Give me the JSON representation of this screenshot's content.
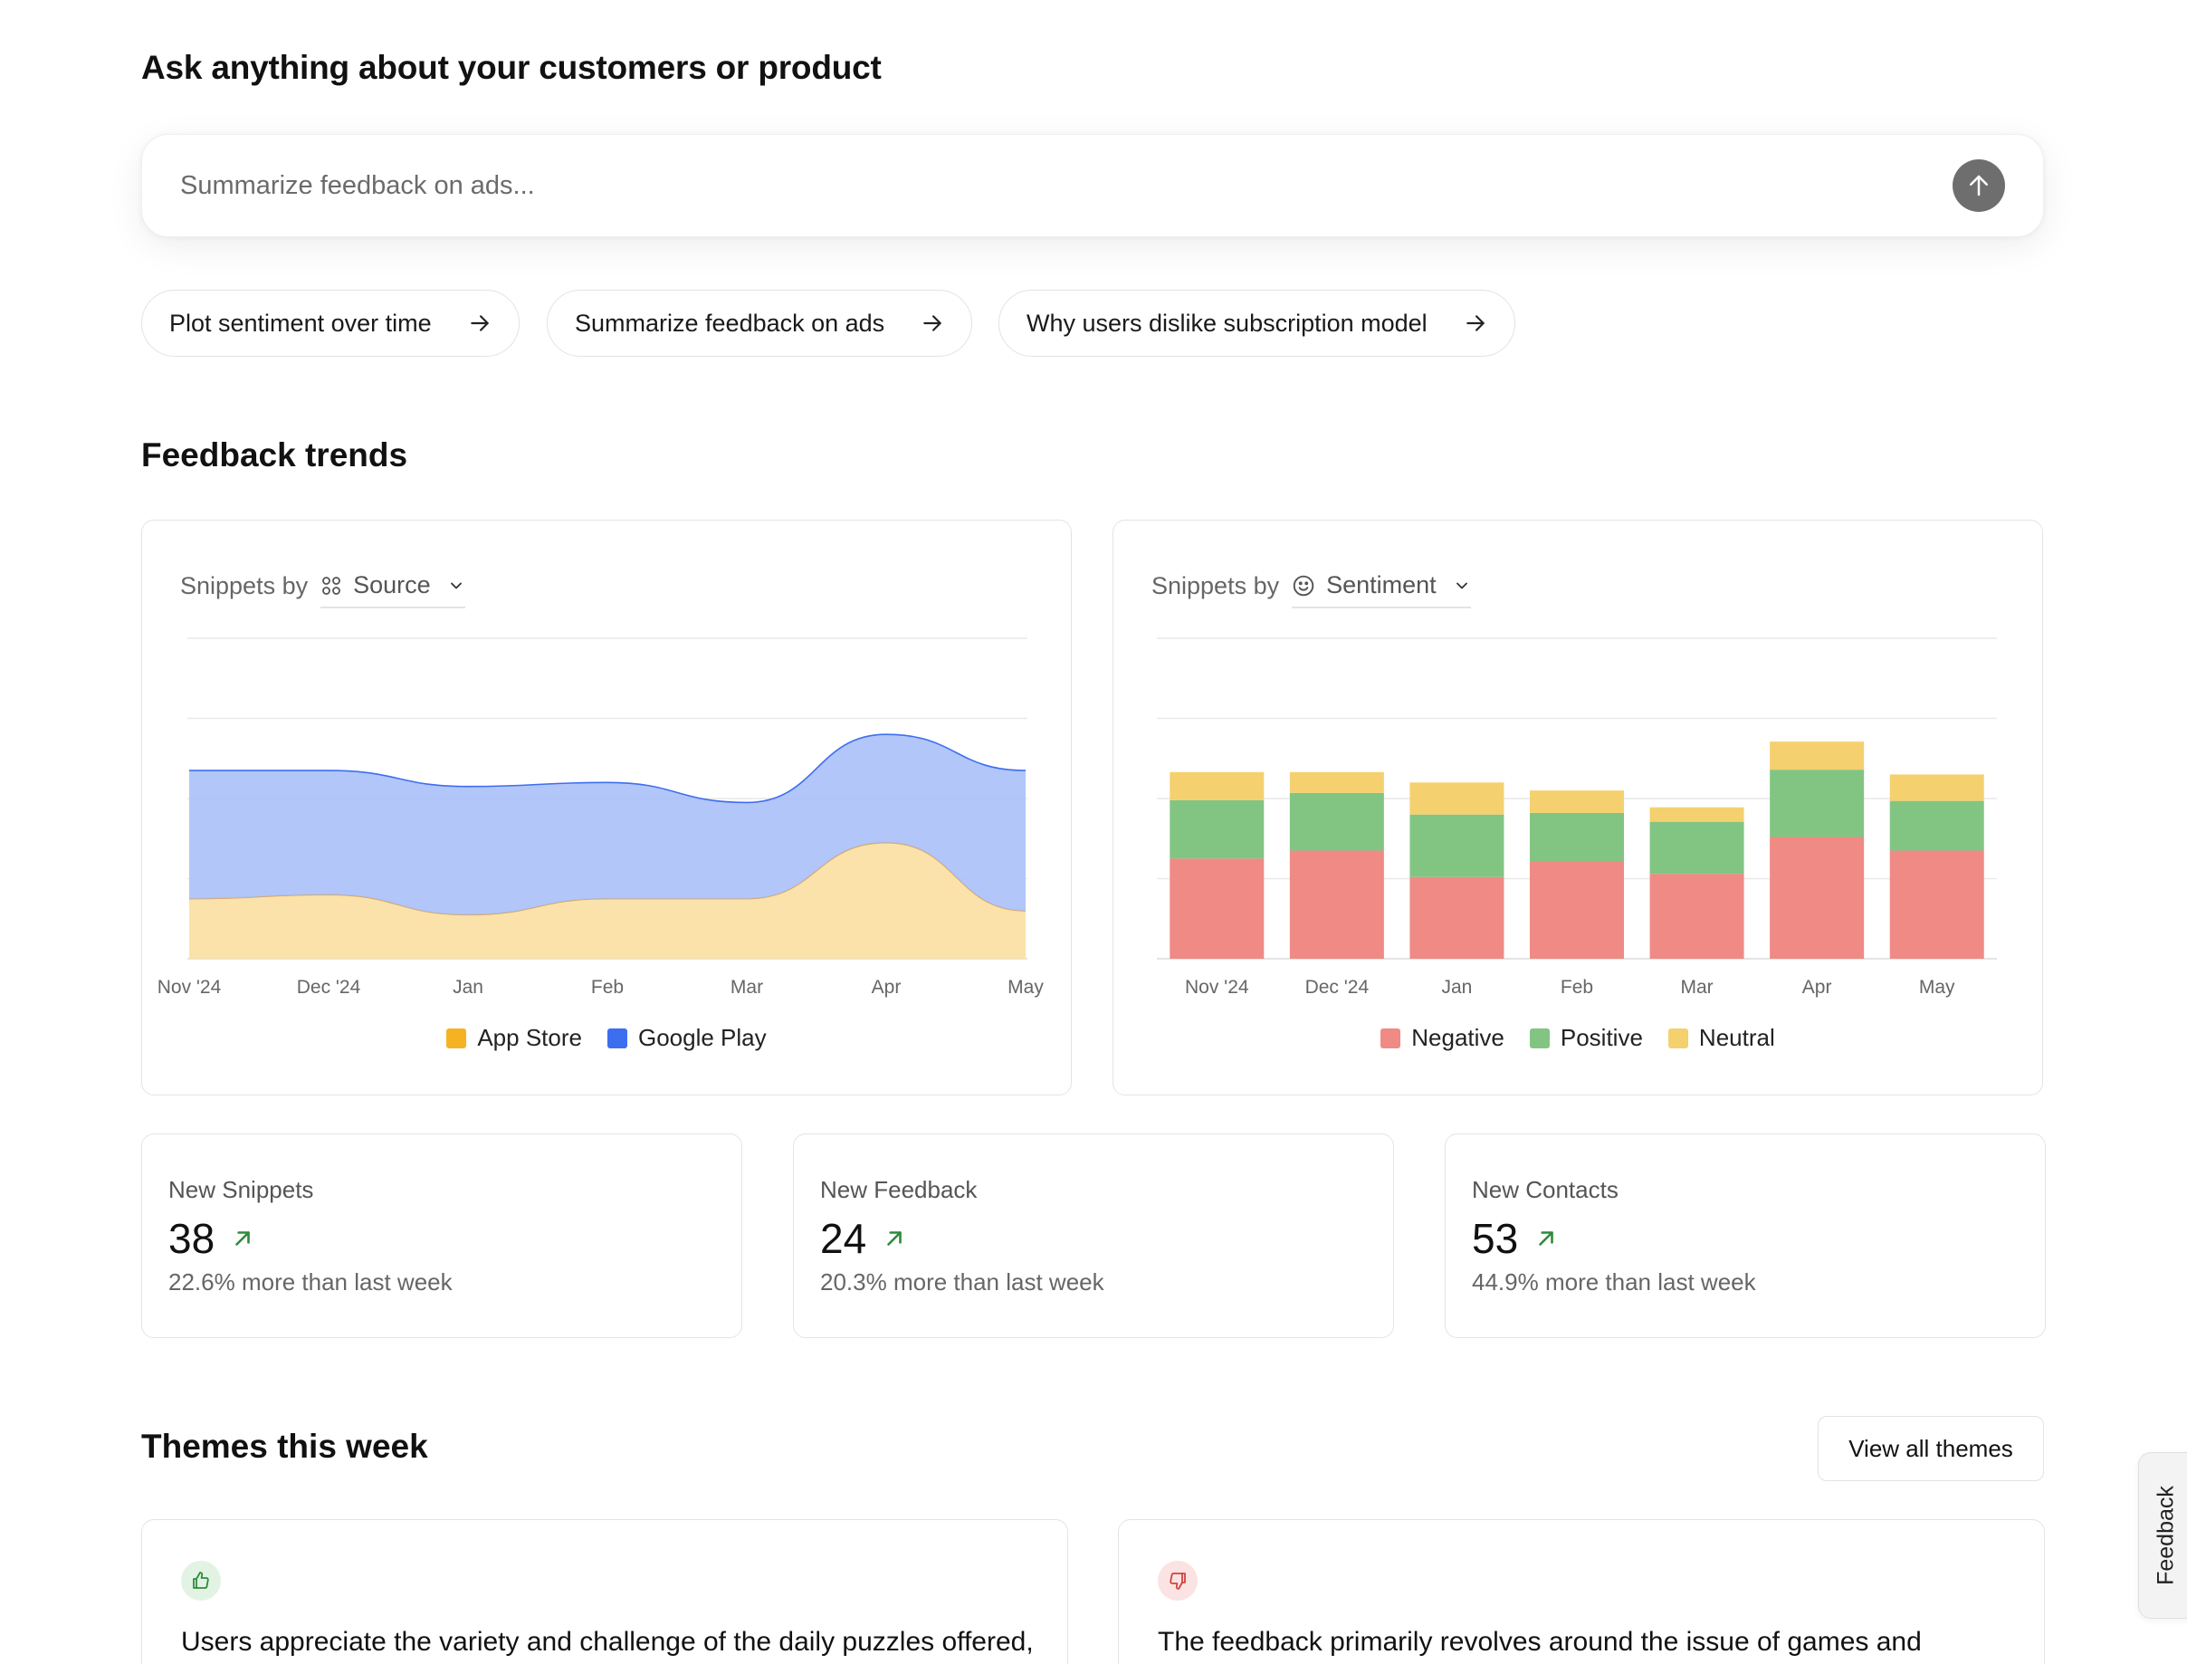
{
  "ask": {
    "title": "Ask anything about your customers or product",
    "placeholder": "Summarize feedback on ads..."
  },
  "suggestions": [
    {
      "label": "Plot sentiment over time"
    },
    {
      "label": "Summarize feedback on ads"
    },
    {
      "label": "Why users dislike subscription model"
    }
  ],
  "trends": {
    "title": "Feedback trends",
    "source_card": {
      "prefix": "Snippets by",
      "selector": "Source"
    },
    "sentiment_card": {
      "prefix": "Snippets by",
      "selector": "Sentiment"
    }
  },
  "chart_data": [
    {
      "type": "area",
      "stacked": true,
      "x": [
        "Nov '24",
        "Dec '24",
        "Jan",
        "Feb",
        "Mar",
        "Apr",
        "May"
      ],
      "ylim": [
        0,
        40
      ],
      "grid": true,
      "legend": "bottom-center",
      "series": [
        {
          "name": "App Store",
          "color": "#f5b324",
          "values": [
            7.5,
            8,
            5.5,
            7.5,
            7.5,
            14.5,
            6
          ]
        },
        {
          "name": "Google Play",
          "color": "#3d6ef0",
          "values": [
            16,
            15.5,
            16,
            14.5,
            12,
            13.5,
            17.5
          ]
        }
      ]
    },
    {
      "type": "bar",
      "stacked": true,
      "categories": [
        "Nov '24",
        "Dec '24",
        "Jan",
        "Feb",
        "Mar",
        "Apr",
        "May"
      ],
      "ylim": [
        0,
        40
      ],
      "grid": true,
      "legend": "bottom-center",
      "series": [
        {
          "name": "Negative",
          "color": "#f08a84",
          "values": [
            12.5,
            13.5,
            10.2,
            12.2,
            10.6,
            15.2,
            13.5
          ]
        },
        {
          "name": "Positive",
          "color": "#82c582",
          "values": [
            7.3,
            7.2,
            7.8,
            6.0,
            6.5,
            8.4,
            6.2
          ]
        },
        {
          "name": "Neutral",
          "color": "#f5d06f",
          "values": [
            3.5,
            2.6,
            4.0,
            2.8,
            1.8,
            3.5,
            3.3
          ]
        }
      ]
    }
  ],
  "stats": [
    {
      "label": "New Snippets",
      "value": "38",
      "sub": "22.6% more than last week"
    },
    {
      "label": "New Feedback",
      "value": "24",
      "sub": "20.3% more than last week"
    },
    {
      "label": "New Contacts",
      "value": "53",
      "sub": "44.9% more than last week"
    }
  ],
  "themes": {
    "title": "Themes this week",
    "view_all": "View all themes",
    "cards": [
      {
        "icon": "thumbs-up-icon",
        "text": "Users appreciate the variety and challenge of the daily puzzles offered,"
      },
      {
        "icon": "thumbs-down-icon",
        "text": "The feedback primarily revolves around the issue of games and"
      }
    ]
  },
  "feedback_tab": {
    "label": "Feedback"
  },
  "colors": {
    "trend_up": "#2e8b3a",
    "positive_bg": "#e3f3e3",
    "negative_bg": "#fbe3e3"
  }
}
